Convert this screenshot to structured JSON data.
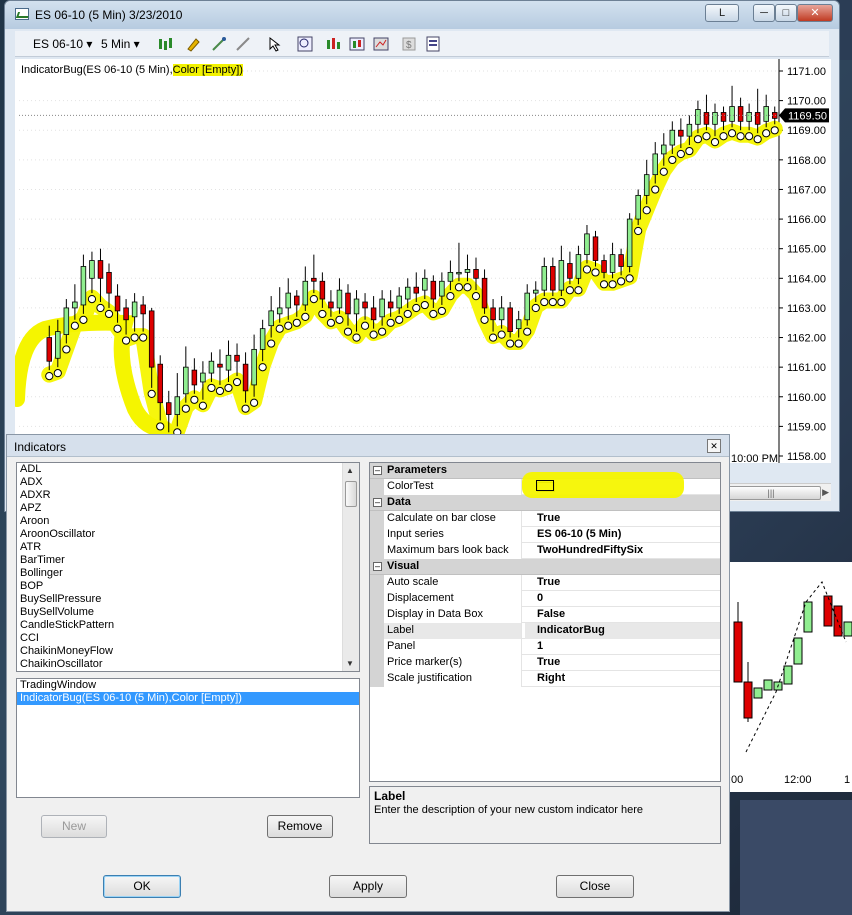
{
  "chart_window": {
    "title": "ES 06-10 (5 Min)  3/23/2010",
    "btn_l": "L",
    "instrument": "ES 06-10",
    "interval": "5 Min",
    "indicator_label_prefix": "IndicatorBug(ES 06-10 (5 Min),",
    "indicator_label_hl": "Color [Empty])",
    "time_label": "10:00 PM",
    "price_marker": "1169.50"
  },
  "chart_data": {
    "type": "candlestick",
    "y_ticks": [
      "1171.00",
      "1170.00",
      "1169.00",
      "1168.00",
      "1167.00",
      "1166.00",
      "1165.00",
      "1164.00",
      "1163.00",
      "1162.00",
      "1161.00",
      "1160.00",
      "1159.00",
      "1158.00"
    ],
    "ylim": [
      1158,
      1171
    ],
    "candles": [
      [
        1162.0,
        1161.2,
        1160.9,
        1162.4
      ],
      [
        1161.3,
        1162.2,
        1161.0,
        1162.6
      ],
      [
        1162.1,
        1163.0,
        1161.8,
        1163.3
      ],
      [
        1163.0,
        1163.2,
        1162.6,
        1163.8
      ],
      [
        1163.1,
        1164.4,
        1162.8,
        1164.8
      ],
      [
        1164.0,
        1164.6,
        1163.5,
        1164.9
      ],
      [
        1164.6,
        1164.0,
        1163.2,
        1165.0
      ],
      [
        1164.2,
        1163.5,
        1163.0,
        1164.5
      ],
      [
        1163.4,
        1162.9,
        1162.5,
        1163.8
      ],
      [
        1163.0,
        1162.6,
        1162.1,
        1163.3
      ],
      [
        1162.7,
        1163.2,
        1162.2,
        1163.5
      ],
      [
        1163.1,
        1162.8,
        1162.2,
        1163.4
      ],
      [
        1162.9,
        1161.0,
        1160.3,
        1163.0
      ],
      [
        1161.1,
        1159.8,
        1159.2,
        1161.4
      ],
      [
        1159.8,
        1159.4,
        1158.8,
        1160.2
      ],
      [
        1159.4,
        1160.0,
        1159.0,
        1160.8
      ],
      [
        1160.1,
        1161.0,
        1159.8,
        1161.7
      ],
      [
        1160.9,
        1160.4,
        1160.1,
        1161.3
      ],
      [
        1160.5,
        1160.8,
        1159.9,
        1161.2
      ],
      [
        1160.8,
        1161.2,
        1160.5,
        1161.5
      ],
      [
        1161.1,
        1161.0,
        1160.4,
        1161.6
      ],
      [
        1160.9,
        1161.4,
        1160.5,
        1161.9
      ],
      [
        1161.4,
        1161.2,
        1160.7,
        1161.8
      ],
      [
        1161.1,
        1160.2,
        1159.8,
        1161.5
      ],
      [
        1160.4,
        1161.6,
        1160.0,
        1162.1
      ],
      [
        1161.6,
        1162.3,
        1161.2,
        1162.6
      ],
      [
        1162.4,
        1162.9,
        1162.0,
        1163.4
      ],
      [
        1162.8,
        1163.0,
        1162.5,
        1163.7
      ],
      [
        1163.0,
        1163.5,
        1162.6,
        1164.0
      ],
      [
        1163.4,
        1163.1,
        1162.7,
        1163.6
      ],
      [
        1163.1,
        1163.9,
        1162.9,
        1164.4
      ],
      [
        1164.0,
        1163.9,
        1163.5,
        1164.8
      ],
      [
        1163.9,
        1163.3,
        1163.0,
        1164.2
      ],
      [
        1163.2,
        1163.0,
        1162.7,
        1163.6
      ],
      [
        1163.0,
        1163.6,
        1162.8,
        1164.0
      ],
      [
        1163.5,
        1162.8,
        1162.4,
        1163.8
      ],
      [
        1162.8,
        1163.3,
        1162.2,
        1163.6
      ],
      [
        1163.2,
        1163.0,
        1162.6,
        1163.5
      ],
      [
        1163.0,
        1162.6,
        1162.3,
        1163.4
      ],
      [
        1162.7,
        1163.3,
        1162.4,
        1163.6
      ],
      [
        1163.2,
        1163.0,
        1162.7,
        1163.6
      ],
      [
        1163.0,
        1163.4,
        1162.8,
        1163.7
      ],
      [
        1163.3,
        1163.7,
        1163.0,
        1164.0
      ],
      [
        1163.7,
        1163.5,
        1163.2,
        1164.2
      ],
      [
        1163.6,
        1164.0,
        1163.3,
        1164.3
      ],
      [
        1163.9,
        1163.3,
        1163.0,
        1164.1
      ],
      [
        1163.4,
        1163.9,
        1163.1,
        1164.2
      ],
      [
        1163.9,
        1164.2,
        1163.6,
        1164.6
      ],
      [
        1164.2,
        1164.2,
        1163.9,
        1165.2
      ],
      [
        1164.2,
        1164.3,
        1163.9,
        1164.8
      ],
      [
        1164.3,
        1164.0,
        1163.6,
        1164.7
      ],
      [
        1164.0,
        1163.0,
        1162.8,
        1164.3
      ],
      [
        1163.0,
        1162.6,
        1162.2,
        1163.3
      ],
      [
        1162.6,
        1163.0,
        1162.3,
        1163.4
      ],
      [
        1163.0,
        1162.2,
        1162.0,
        1163.2
      ],
      [
        1162.3,
        1162.6,
        1162.0,
        1162.9
      ],
      [
        1162.6,
        1163.5,
        1162.4,
        1163.8
      ],
      [
        1163.5,
        1163.6,
        1163.2,
        1163.9
      ],
      [
        1163.6,
        1164.4,
        1163.4,
        1164.7
      ],
      [
        1164.4,
        1163.6,
        1163.4,
        1164.7
      ],
      [
        1163.6,
        1164.6,
        1163.4,
        1165.1
      ],
      [
        1164.5,
        1164.0,
        1163.8,
        1164.9
      ],
      [
        1164.0,
        1164.8,
        1163.8,
        1165.1
      ],
      [
        1164.8,
        1165.5,
        1164.5,
        1165.8
      ],
      [
        1165.4,
        1164.6,
        1164.4,
        1165.6
      ],
      [
        1164.6,
        1164.2,
        1164.0,
        1164.8
      ],
      [
        1164.2,
        1164.8,
        1164.0,
        1165.2
      ],
      [
        1164.8,
        1164.4,
        1164.1,
        1165.0
      ],
      [
        1164.4,
        1166.0,
        1164.2,
        1166.2
      ],
      [
        1166.0,
        1166.8,
        1165.8,
        1167.0
      ],
      [
        1166.8,
        1167.5,
        1166.5,
        1168.0
      ],
      [
        1167.5,
        1168.2,
        1167.2,
        1168.6
      ],
      [
        1168.2,
        1168.5,
        1167.8,
        1168.9
      ],
      [
        1168.5,
        1169.0,
        1168.2,
        1169.3
      ],
      [
        1169.0,
        1168.8,
        1168.4,
        1169.4
      ],
      [
        1168.8,
        1169.2,
        1168.5,
        1169.5
      ],
      [
        1169.2,
        1169.7,
        1168.9,
        1170.0
      ],
      [
        1169.6,
        1169.2,
        1169.0,
        1170.2
      ],
      [
        1169.2,
        1169.6,
        1168.8,
        1169.9
      ],
      [
        1169.6,
        1169.3,
        1169.0,
        1169.8
      ],
      [
        1169.3,
        1169.8,
        1169.1,
        1170.5
      ],
      [
        1169.8,
        1169.3,
        1169.0,
        1170.1
      ],
      [
        1169.3,
        1169.6,
        1169.0,
        1169.9
      ],
      [
        1169.6,
        1169.2,
        1168.9,
        1170.4
      ],
      [
        1169.3,
        1169.8,
        1169.1,
        1170.2
      ],
      [
        1169.6,
        1169.4,
        1169.2,
        1169.8
      ]
    ]
  },
  "indicators_dialog": {
    "title": "Indicators",
    "available": [
      "ADL",
      "ADX",
      "ADXR",
      "APZ",
      "Aroon",
      "AroonOscillator",
      "ATR",
      "BarTimer",
      "Bollinger",
      "BOP",
      "BuySellPressure",
      "BuySellVolume",
      "CandleStickPattern",
      "CCI",
      "ChaikinMoneyFlow",
      "ChaikinOscillator"
    ],
    "applied": [
      "TradingWindow",
      "IndicatorBug(ES 06-10 (5 Min),Color [Empty])"
    ],
    "buttons": {
      "new": "New",
      "remove": "Remove",
      "ok": "OK",
      "apply": "Apply",
      "close": "Close"
    },
    "properties": {
      "cat_parameters": "Parameters",
      "color_test": "ColorTest",
      "cat_data": "Data",
      "calc_label": "Calculate on bar close",
      "calc_value": "True",
      "input_label": "Input series",
      "input_value": "ES 06-10 (5 Min)",
      "maxbars_label": "Maximum bars look back",
      "maxbars_value": "TwoHundredFiftySix",
      "cat_visual": "Visual",
      "autoscale_label": "Auto scale",
      "autoscale_value": "True",
      "displacement_label": "Displacement",
      "displacement_value": "0",
      "databox_label": "Display in Data Box",
      "databox_value": "False",
      "label_label": "Label",
      "label_value": "IndicatorBug",
      "panel_label": "Panel",
      "panel_value": "1",
      "marker_label": "Price marker(s)",
      "marker_value": "True",
      "scalej_label": "Scale justification",
      "scalej_value": "Right"
    },
    "description_title": "Label",
    "description_text": "Enter the description of your new custom indicator here"
  },
  "chart2": {
    "x1": ":00",
    "x2": "12:00",
    "x3": "1"
  },
  "colors": {
    "up": "#90ee90",
    "down": "#dd0000",
    "highlight": "#f5f500",
    "selection": "#3399ff"
  }
}
